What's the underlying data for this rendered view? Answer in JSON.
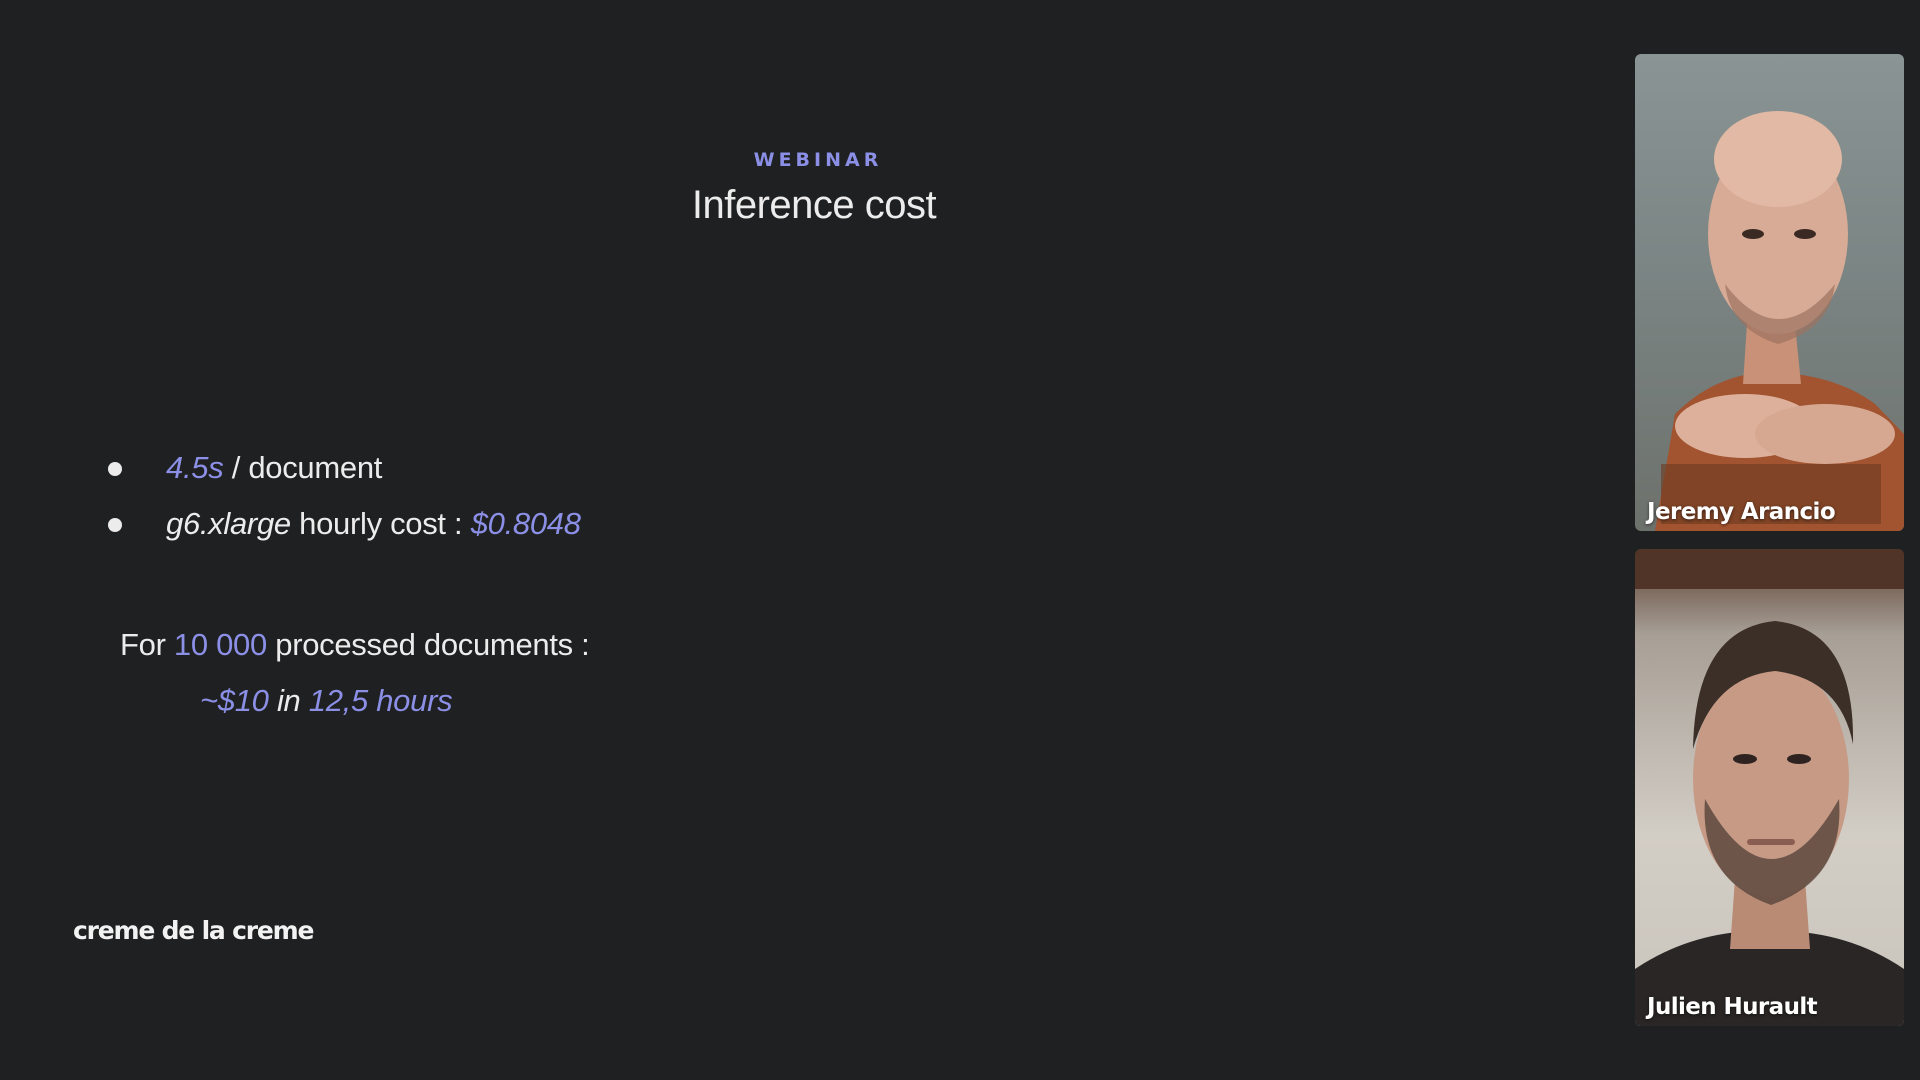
{
  "slide": {
    "eyebrow": "WEBINAR",
    "title": "Inference cost",
    "bullets": [
      {
        "value": "4.5s",
        "text": " / document"
      },
      {
        "instance": "g6.xlarge",
        "text": " hourly cost : ",
        "value": "$0.8048"
      }
    ],
    "summary": {
      "prefix": "For ",
      "count": "10 000",
      "suffix": " processed documents :",
      "cost": "~$10",
      "joiner": " in ",
      "duration": "12,5 hours"
    },
    "brand": "creme de la creme"
  },
  "participants": [
    {
      "name": "Jeremy Arancio"
    },
    {
      "name": "Julien Hurault"
    }
  ],
  "colors": {
    "background": "#1f2021",
    "accent": "#8b8fe6",
    "text": "#ececec"
  }
}
